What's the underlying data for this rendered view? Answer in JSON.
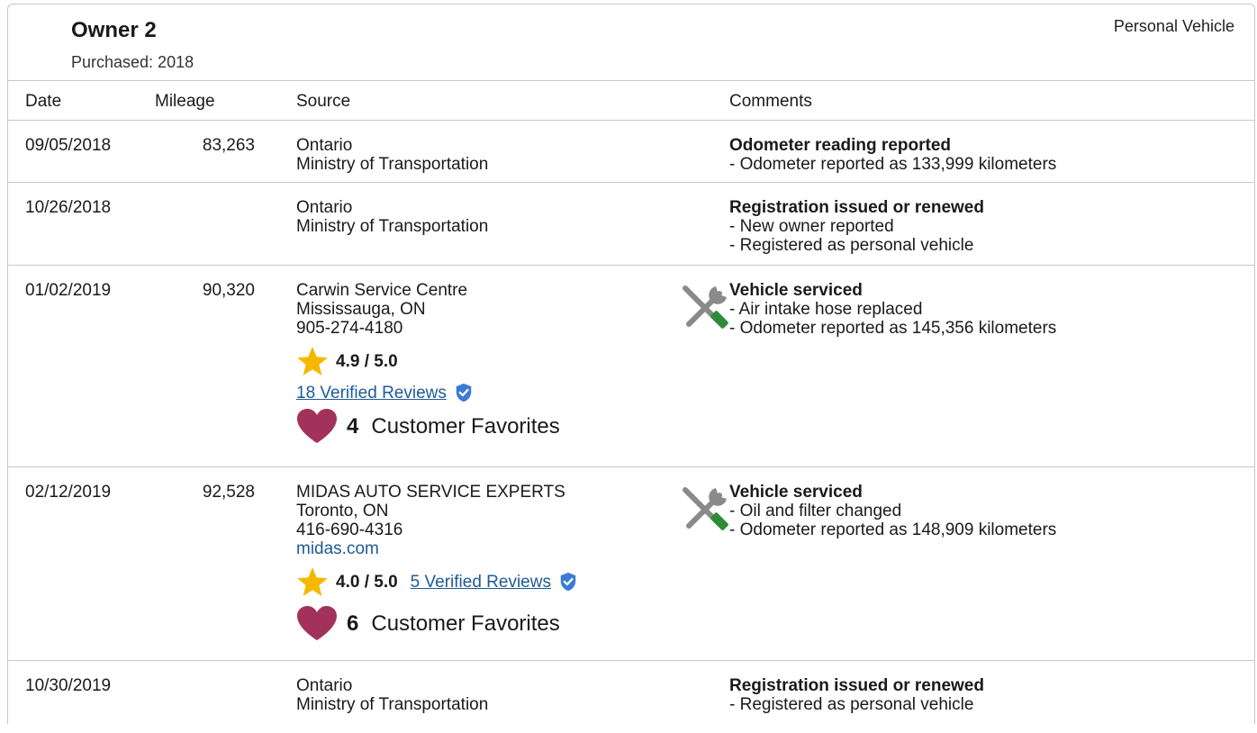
{
  "owner": {
    "title": "Owner 2",
    "purchased": "Purchased: 2018",
    "vehicle_type": "Personal Vehicle"
  },
  "columns": {
    "date": "Date",
    "mileage": "Mileage",
    "source": "Source",
    "comments": "Comments"
  },
  "rows": [
    {
      "date": "09/05/2018",
      "mileage": "83,263",
      "source": [
        "Ontario",
        "Ministry of Transportation"
      ],
      "comment_title": "Odometer reading reported",
      "comment_lines": [
        "- Odometer reported as 133,999 kilometers"
      ]
    },
    {
      "date": "10/26/2018",
      "mileage": "",
      "source": [
        "Ontario",
        "Ministry of Transportation"
      ],
      "comment_title": "Registration issued or renewed",
      "comment_lines": [
        "- New owner reported",
        "- Registered as personal vehicle"
      ]
    },
    {
      "date": "01/02/2019",
      "mileage": "90,320",
      "source": [
        "Carwin Service Centre",
        "Mississauga, ON",
        "905-274-4180"
      ],
      "rating": "4.9 / 5.0",
      "reviews": "18 Verified Reviews",
      "favorites_count": "4",
      "favorites_label": "Customer Favorites",
      "comment_title": "Vehicle serviced",
      "comment_lines": [
        "- Air intake hose replaced",
        "- Odometer reported as 145,356 kilometers"
      ]
    },
    {
      "date": "02/12/2019",
      "mileage": "92,528",
      "source": [
        "MIDAS AUTO SERVICE EXPERTS",
        "Toronto, ON",
        "416-690-4316"
      ],
      "website": "midas.com",
      "rating": "4.0 / 5.0",
      "reviews": "5 Verified Reviews",
      "favorites_count": "6",
      "favorites_label": "Customer Favorites",
      "comment_title": "Vehicle serviced",
      "comment_lines": [
        "- Oil and filter changed",
        "- Odometer reported as 148,909 kilometers"
      ]
    },
    {
      "date": "10/30/2019",
      "mileage": "",
      "source": [
        "Ontario",
        "Ministry of Transportation"
      ],
      "comment_title": "Registration issued or renewed",
      "comment_lines": [
        "- Registered as personal vehicle"
      ]
    }
  ],
  "colors": {
    "star": "#f5b800",
    "heart": "#a3325a",
    "link": "#1f5a96",
    "shield": "#3a7bd5",
    "tool_gray": "#8a8a8a",
    "tool_green": "#2e8b3a"
  }
}
